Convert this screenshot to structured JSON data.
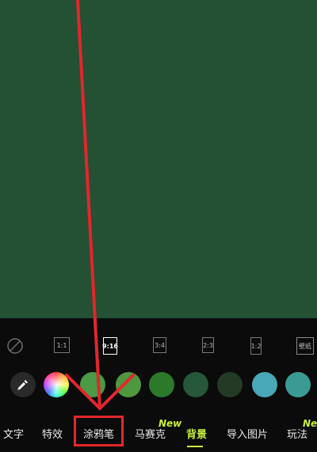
{
  "canvas": {
    "background": "#245033"
  },
  "aspect_ratios": [
    {
      "label": "1:1"
    },
    {
      "label": "9:16"
    },
    {
      "label": "3:4"
    },
    {
      "label": "2:3"
    },
    {
      "label": "1:2"
    },
    {
      "label": "壁纸"
    }
  ],
  "selected_ratio": "9:16",
  "colors": [
    "#4a9a46",
    "#4e9940",
    "#2b7a2a",
    "#25573a",
    "#243a25",
    "#48a8b7",
    "#3a9b93"
  ],
  "tabs": [
    {
      "label": "文字"
    },
    {
      "label": "特效"
    },
    {
      "label": "涂鸦笔"
    },
    {
      "label": "马赛克"
    },
    {
      "label": "背景"
    },
    {
      "label": "导入图片"
    },
    {
      "label": "玩法"
    }
  ],
  "active_tab": "背景",
  "badges": {
    "mosaic_new": "New",
    "play_new": "New"
  },
  "accent_color": "#c7f03a",
  "annotation_color": "#e3262c"
}
